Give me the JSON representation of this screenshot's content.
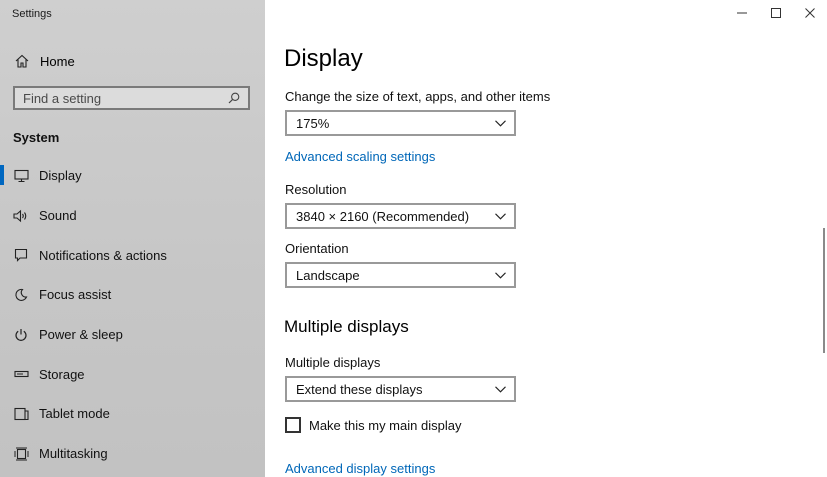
{
  "app": {
    "title": "Settings"
  },
  "sidebar": {
    "home_label": "Home",
    "search_placeholder": "Find a setting",
    "section_title": "System",
    "items": [
      {
        "label": "Display",
        "icon": "monitor-icon",
        "active": true
      },
      {
        "label": "Sound",
        "icon": "speaker-icon"
      },
      {
        "label": "Notifications & actions",
        "icon": "notification-icon"
      },
      {
        "label": "Focus assist",
        "icon": "moon-icon"
      },
      {
        "label": "Power & sleep",
        "icon": "power-icon"
      },
      {
        "label": "Storage",
        "icon": "storage-icon"
      },
      {
        "label": "Tablet mode",
        "icon": "tablet-icon"
      },
      {
        "label": "Multitasking",
        "icon": "multitasking-icon"
      }
    ]
  },
  "main": {
    "title": "Display",
    "scale": {
      "label": "Change the size of text, apps, and other items",
      "value": "175%",
      "link": "Advanced scaling settings"
    },
    "resolution": {
      "label": "Resolution",
      "value": "3840 × 2160 (Recommended)"
    },
    "orientation": {
      "label": "Orientation",
      "value": "Landscape"
    },
    "multiple_displays": {
      "heading": "Multiple displays",
      "label": "Multiple displays",
      "value": "Extend these displays",
      "main_display_checkbox": "Make this my main display",
      "checked": false,
      "link": "Advanced display settings"
    }
  },
  "colors": {
    "accent": "#0067c0",
    "link": "#0067b8",
    "sidebar_bg": "#c9c9c9"
  }
}
